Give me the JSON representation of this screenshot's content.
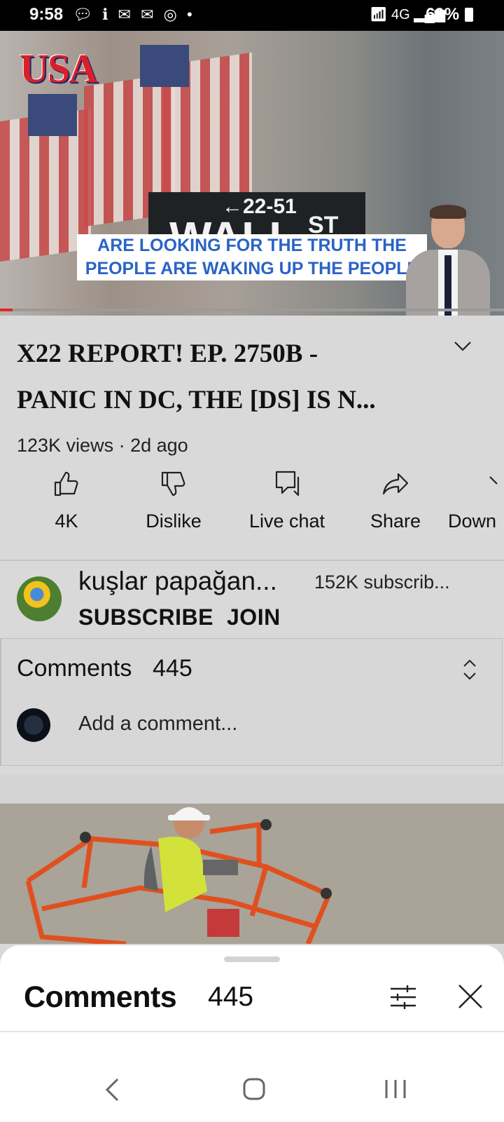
{
  "status_bar": {
    "time": "9:58",
    "notification_icons": [
      "chat-bubble-icon",
      "info-icon",
      "mail-icon",
      "mail-icon",
      "chrome-icon",
      "dot-icon"
    ],
    "network": "4G",
    "battery": "69%"
  },
  "video": {
    "overlay_logo": "USA",
    "sign_arrow": "←22-51",
    "sign_wall": "WALL",
    "sign_st": "ST",
    "caption_line1": "ARE LOOKING FOR THE TRUTH THE",
    "caption_line2": "PEOPLE ARE WAKING UP THE PEOPLE",
    "progress": 0.025
  },
  "title": {
    "line1": "X22 REPORT! EP. 2750B -",
    "line2": "PANIC IN DC, THE [DS] IS N..."
  },
  "meta": "123K views · 2d ago",
  "actions": [
    {
      "label": "4K",
      "icon": "thumbs-up-icon"
    },
    {
      "label": "Dislike",
      "icon": "thumbs-down-icon"
    },
    {
      "label": "Live chat",
      "icon": "chat-icon"
    },
    {
      "label": "Share",
      "icon": "share-icon"
    },
    {
      "label": "Down",
      "icon": "download-icon"
    }
  ],
  "channel": {
    "name": "kuşlar papağan...",
    "subscribers": "152K subscrib...",
    "subscribe": "SUBSCRIBE",
    "join": "JOIN"
  },
  "comments_teaser": {
    "label": "Comments",
    "count": "445",
    "placeholder": "Add a comment..."
  },
  "sheet": {
    "title": "Comments",
    "count": "445"
  },
  "colors": {
    "accent_red": "#e1262d",
    "caption_blue": "#2a63c6"
  }
}
